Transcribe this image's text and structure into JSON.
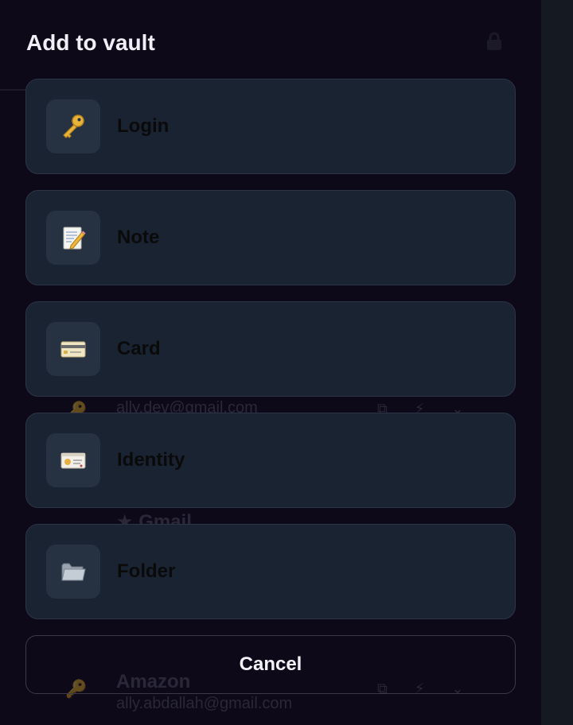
{
  "sheet": {
    "title": "Add to vault",
    "cancel_label": "Cancel"
  },
  "options": [
    {
      "label": "Login",
      "icon": "key-icon"
    },
    {
      "label": "Note",
      "icon": "memo-icon"
    },
    {
      "label": "Card",
      "icon": "credit-card-icon"
    },
    {
      "label": "Identity",
      "icon": "id-card-icon"
    },
    {
      "label": "Folder",
      "icon": "folder-icon"
    }
  ],
  "background": {
    "rows": [
      {
        "title": "",
        "subtitle": "ally.dev@gmail.com"
      },
      {
        "title": "Gmail",
        "subtitle": ""
      },
      {
        "title": "Amazon",
        "subtitle": "ally.abdallah@gmail.com"
      }
    ]
  },
  "colors": {
    "backdrop": "#0c0818",
    "card": "#1a2332",
    "card_border": "#2c3546",
    "icon_tile": "#263142",
    "title_text": "#f1eef8"
  }
}
